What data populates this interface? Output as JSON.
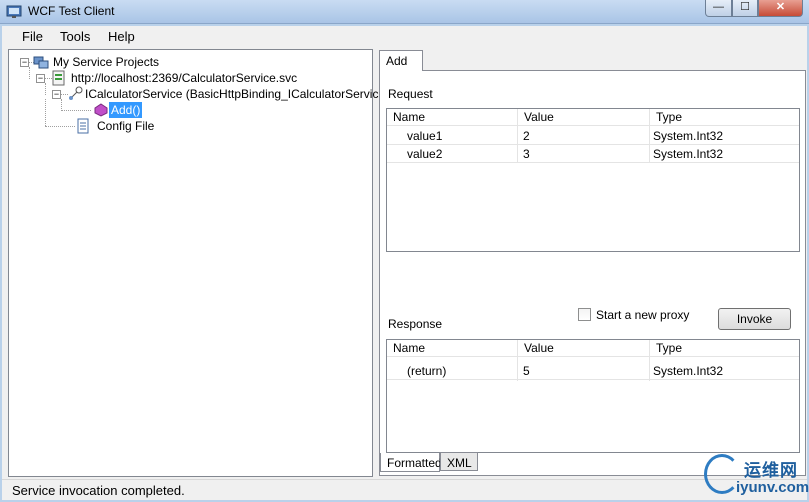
{
  "window": {
    "title": "WCF Test Client",
    "min_glyph": "—",
    "max_glyph": "☐",
    "close_glyph": "✕"
  },
  "menu": {
    "items": [
      "File",
      "Tools",
      "Help"
    ]
  },
  "tree": {
    "root": "My Service Projects",
    "endpoint": "http://localhost:2369/CalculatorService.svc",
    "contract": "ICalculatorService (BasicHttpBinding_ICalculatorService)",
    "operation": "Add()",
    "config": "Config File",
    "expander_minus": "−"
  },
  "tab": {
    "label": "Add"
  },
  "request": {
    "label": "Request",
    "headers": [
      "Name",
      "Value",
      "Type"
    ],
    "rows": [
      {
        "name": "value1",
        "value": "2",
        "type": "System.Int32"
      },
      {
        "name": "value2",
        "value": "3",
        "type": "System.Int32"
      }
    ]
  },
  "proxy": {
    "label": "Start a new proxy",
    "checked": false
  },
  "invoke": {
    "label": "Invoke"
  },
  "response": {
    "label": "Response",
    "headers": [
      "Name",
      "Value",
      "Type"
    ],
    "rows": [
      {
        "name": "(return)",
        "value": "5",
        "type": "System.Int32"
      }
    ]
  },
  "bottom_tabs": [
    "Formatted",
    "XML"
  ],
  "status": {
    "text": "Service invocation completed."
  },
  "watermark": {
    "cn": "运维网",
    "url": "iyunv.com"
  },
  "colors": {
    "selection": "#3399ff",
    "titlebar": "#b9d1ea",
    "close": "#c74b36"
  }
}
